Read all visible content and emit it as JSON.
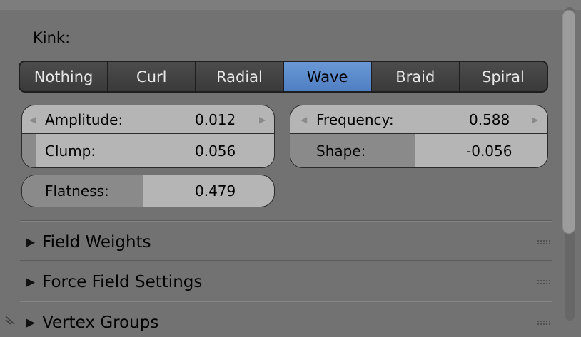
{
  "kink": {
    "label": "Kink:",
    "options": [
      "Nothing",
      "Curl",
      "Radial",
      "Wave",
      "Braid",
      "Spiral"
    ],
    "selected": "Wave"
  },
  "fields": {
    "amplitude": {
      "label": "Amplitude:",
      "value": "0.012"
    },
    "frequency": {
      "label": "Frequency:",
      "value": "0.588"
    },
    "clump": {
      "label": "Clump:",
      "value": "0.056",
      "fill": 0.056
    },
    "shape": {
      "label": "Shape:",
      "value": "-0.056",
      "fill": 0.486
    },
    "flatness": {
      "label": "Flatness:",
      "value": "0.479",
      "fill": 0.479
    }
  },
  "sections": [
    {
      "label": "Field Weights"
    },
    {
      "label": "Force Field Settings"
    },
    {
      "label": "Vertex Groups"
    }
  ],
  "icons": {
    "arrow_left": "◀",
    "arrow_right": "▶",
    "collapse": "▶"
  },
  "colors": {
    "panel_bg": "#727272",
    "active_option": "#5a88cc",
    "field_bg": "#b5b5b5",
    "field_fill": "#8a8a8a"
  }
}
